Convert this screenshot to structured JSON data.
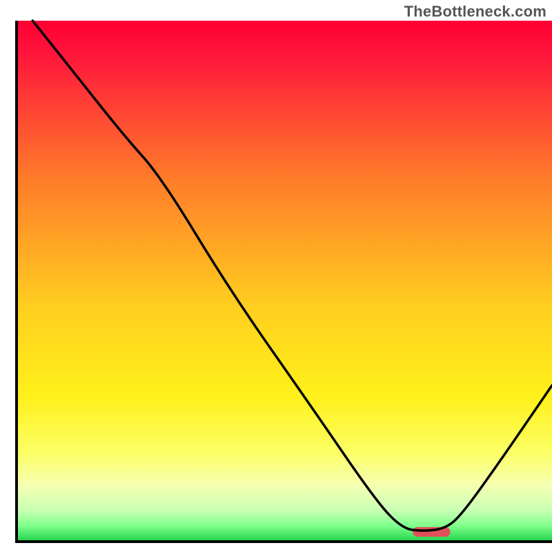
{
  "watermark": "TheBottleneck.com",
  "chart_data": {
    "type": "line",
    "title": "",
    "xlabel": "",
    "ylabel": "",
    "xlim": [
      0,
      100
    ],
    "ylim": [
      0,
      100
    ],
    "x": [
      3,
      10,
      20,
      27,
      40,
      55,
      67,
      72,
      76,
      80,
      83,
      90,
      100
    ],
    "values": [
      100,
      91,
      78,
      70,
      48,
      26,
      8,
      2.5,
      2,
      2.5,
      5,
      15,
      30
    ],
    "gradient_stops": [
      {
        "offset": 0,
        "color": "#ff0033"
      },
      {
        "offset": 6,
        "color": "#ff143c"
      },
      {
        "offset": 30,
        "color": "#ff7a2a"
      },
      {
        "offset": 55,
        "color": "#ffcf1f"
      },
      {
        "offset": 72,
        "color": "#fff01a"
      },
      {
        "offset": 83,
        "color": "#fcff66"
      },
      {
        "offset": 89,
        "color": "#f6ffb0"
      },
      {
        "offset": 94,
        "color": "#c9ffb4"
      },
      {
        "offset": 97,
        "color": "#7eff8a"
      },
      {
        "offset": 100,
        "color": "#1fd04a"
      }
    ],
    "marker": {
      "x": 77.5,
      "y": 2,
      "width": 7,
      "color": "#e0505a"
    },
    "frame_color": "#000000"
  }
}
